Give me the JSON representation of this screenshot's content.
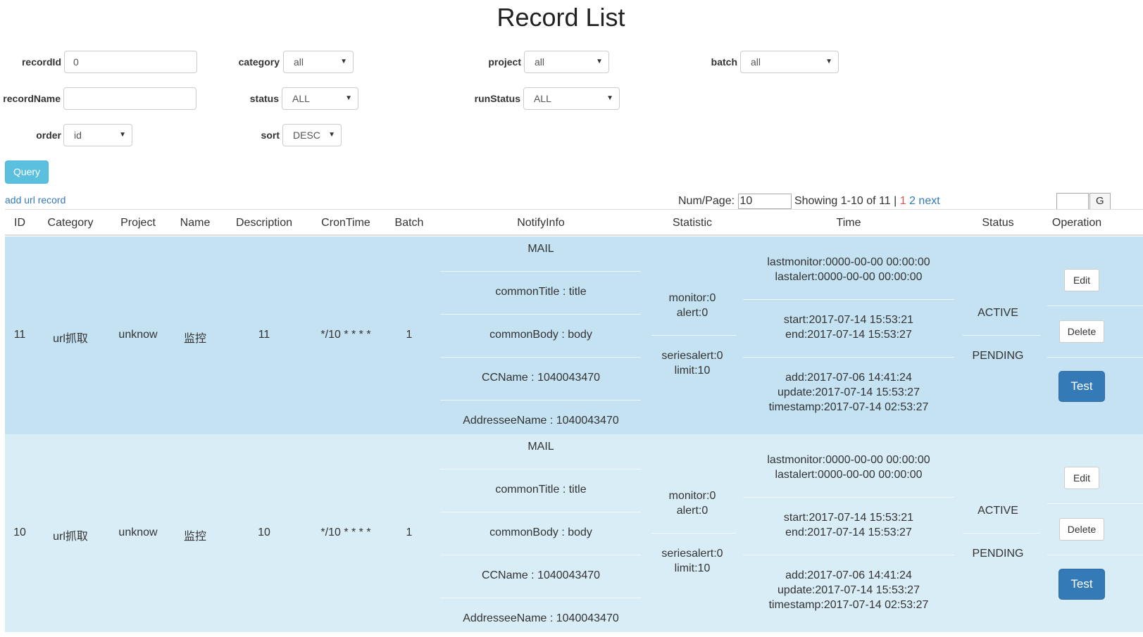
{
  "page": {
    "title": "Record List"
  },
  "filters": {
    "recordId": {
      "label": "recordId",
      "value": "0"
    },
    "category": {
      "label": "category",
      "value": "all"
    },
    "project": {
      "label": "project",
      "value": "all"
    },
    "batch": {
      "label": "batch",
      "value": "all"
    },
    "recordName": {
      "label": "recordName",
      "value": ""
    },
    "status": {
      "label": "status",
      "value": "ALL"
    },
    "runStatus": {
      "label": "runStatus",
      "value": "ALL"
    },
    "order": {
      "label": "order",
      "value": "id"
    },
    "sort": {
      "label": "sort",
      "value": "DESC"
    },
    "query_label": "Query"
  },
  "add_link": "add url record",
  "pagination": {
    "num_label": "Num/Page:",
    "num_value": "10",
    "showing": "Showing 1-10 of 11 |",
    "current_page": "1",
    "page2": "2",
    "next": "next",
    "goto_label": "G"
  },
  "table": {
    "headers": [
      "ID",
      "Category",
      "Project",
      "Name",
      "Description",
      "CronTime",
      "Batch",
      "NotifyInfo",
      "Statistic",
      "Time",
      "Status",
      "Operation"
    ],
    "rows": [
      {
        "id": "11",
        "category": "url抓取",
        "project": "unknow",
        "name": "监控",
        "description": "11",
        "crontime": "*/10 * * * *",
        "batch": "1",
        "notify": [
          "MAIL",
          "commonTitle : title",
          "commonBody : body",
          "CCName : 1040043470",
          "AddresseeName : 1040043470"
        ],
        "stat": {
          "monitor": "monitor:0",
          "alert": "alert:0",
          "seriesalert": "seriesalert:0",
          "limit": "limit:10"
        },
        "time": {
          "lastmonitor": "lastmonitor:0000-00-00 00:00:00",
          "lastalert": "lastalert:0000-00-00 00:00:00",
          "start": "start:2017-07-14 15:53:21",
          "end": "end:2017-07-14 15:53:27",
          "add": "add:2017-07-06 14:41:24",
          "update": "update:2017-07-14 15:53:27",
          "timestamp": "timestamp:2017-07-14 02:53:27"
        },
        "status": "ACTIVE",
        "run_status": "PENDING",
        "ops": {
          "edit": "Edit",
          "delete": "Delete",
          "test": "Test"
        }
      },
      {
        "id": "10",
        "category": "url抓取",
        "project": "unknow",
        "name": "监控",
        "description": "10",
        "crontime": "*/10 * * * *",
        "batch": "1",
        "notify": [
          "MAIL",
          "commonTitle : title",
          "commonBody : body",
          "CCName : 1040043470",
          "AddresseeName : 1040043470"
        ],
        "stat": {
          "monitor": "monitor:0",
          "alert": "alert:0",
          "seriesalert": "seriesalert:0",
          "limit": "limit:10"
        },
        "time": {
          "lastmonitor": "lastmonitor:0000-00-00 00:00:00",
          "lastalert": "lastalert:0000-00-00 00:00:00",
          "start": "start:2017-07-14 15:53:21",
          "end": "end:2017-07-14 15:53:27",
          "add": "add:2017-07-06 14:41:24",
          "update": "update:2017-07-14 15:53:27",
          "timestamp": "timestamp:2017-07-14 02:53:27"
        },
        "status": "ACTIVE",
        "run_status": "PENDING",
        "ops": {
          "edit": "Edit",
          "delete": "Delete",
          "test": "Test"
        }
      }
    ]
  }
}
